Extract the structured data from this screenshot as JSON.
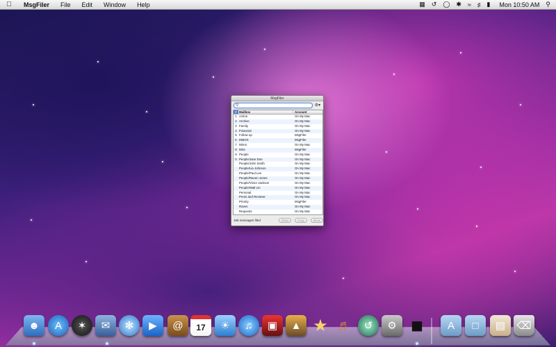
{
  "menubar": {
    "app_name": "MsgFiler",
    "menus": [
      "File",
      "Edit",
      "Window",
      "Help"
    ],
    "clock": "Mon 10:50 AM"
  },
  "window": {
    "title": "MsgFiler",
    "search": {
      "value": "",
      "placeholder": ""
    },
    "columns": {
      "number": "#",
      "mailbox": "Mailbox",
      "account": "Account"
    },
    "rows": [
      {
        "num": "1",
        "mailbox": "Action",
        "account": "On My Mac"
      },
      {
        "num": "2",
        "mailbox": "Archive",
        "account": "On My Mac"
      },
      {
        "num": "3",
        "mailbox": "Family",
        "account": "On My Mac"
      },
      {
        "num": "4",
        "mailbox": "Financial",
        "account": "On My Mac"
      },
      {
        "num": "5",
        "mailbox": "Follow up",
        "account": "MsgFiler"
      },
      {
        "num": "6",
        "mailbox": "INBOX",
        "account": "MsgFiler"
      },
      {
        "num": "7",
        "mailbox": "Mirror",
        "account": "On My Mac"
      },
      {
        "num": "8",
        "mailbox": "Misc",
        "account": "MsgFiler"
      },
      {
        "num": "9",
        "mailbox": "People",
        "account": "On My Mac"
      },
      {
        "num": "0",
        "mailbox": "People/Jane Doe",
        "account": "On My Mac"
      },
      {
        "num": "",
        "mailbox": "People/John Smith",
        "account": "On My Mac"
      },
      {
        "num": "",
        "mailbox": "People/Lia Johnson",
        "account": "On My Mac"
      },
      {
        "num": "",
        "mailbox": "People/Paul Lee",
        "account": "On My Mac"
      },
      {
        "num": "",
        "mailbox": "People/Raven Jones",
        "account": "On My Mac"
      },
      {
        "num": "",
        "mailbox": "People/Victor Jackson",
        "account": "On My Mac"
      },
      {
        "num": "",
        "mailbox": "People/Walt Lin",
        "account": "On My Mac"
      },
      {
        "num": "",
        "mailbox": "Personal",
        "account": "On My Mac"
      },
      {
        "num": "",
        "mailbox": "Press and Reviews",
        "account": "On My Mac"
      },
      {
        "num": "",
        "mailbox": "Priority",
        "account": "MsgFiler"
      },
      {
        "num": "",
        "mailbox": "Raves",
        "account": "On My Mac"
      },
      {
        "num": "",
        "mailbox": "Requests",
        "account": "On My Mac"
      }
    ],
    "status": "169 messages filed",
    "buttons": {
      "show": "Show",
      "copy": "Copy",
      "move": "Move"
    }
  },
  "dock": {
    "calendar_day": "17"
  }
}
